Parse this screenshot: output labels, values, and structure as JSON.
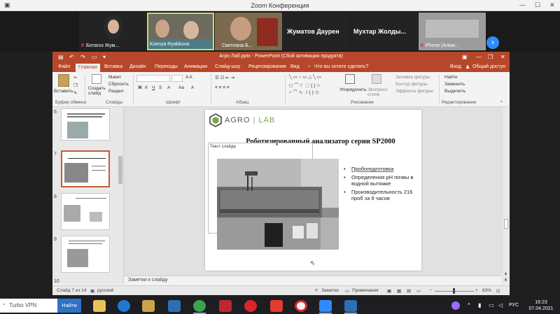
{
  "zoom": {
    "window_title": "Zoom Конференция",
    "participants": [
      {
        "name": "Ботагоз Жум..."
      },
      {
        "name": "Ksenya Ryabkova"
      },
      {
        "name": "Светлана Б..."
      },
      {
        "name": "Жуматов Даурен"
      },
      {
        "name": "Мухтар  Жолды..."
      },
      {
        "name": "Phone (Алма..."
      }
    ],
    "next_arrow": "›"
  },
  "ppt": {
    "window_title": "Агро Лаб.pptx - PowerPoint (Сбой активации продукта)",
    "tabs": [
      "Файл",
      "Главная",
      "Вставка",
      "Дизайн",
      "Переходы",
      "Анимации",
      "Слайд-шоу",
      "Рецензирование",
      "Вид"
    ],
    "tell_me": "Что вы хотите сделать?",
    "signin": "Вход",
    "share": "Общий доступ",
    "ribbon": {
      "paste": "Вставить",
      "create_slide": "Создать слайд",
      "layout": "Макет",
      "reset": "Сбросить",
      "section": "Раздел",
      "arrange": "Упорядочить",
      "quick_styles": "Экспресс-стили",
      "shape_fill": "Заливка фигуры",
      "shape_outline": "Контур фигуры",
      "shape_effects": "Эффекты фигуры",
      "find": "Найти",
      "replace": "Заменить",
      "select": "Выделить",
      "groups": {
        "clipboard": "Буфер обмена",
        "slides": "Слайды",
        "font": "Шрифт",
        "paragraph": "Абзац",
        "drawing": "Рисование",
        "editing": "Редактирование"
      }
    },
    "thumbs": [
      {
        "num": "6"
      },
      {
        "num": "7"
      },
      {
        "num": "8"
      },
      {
        "num": "9"
      },
      {
        "num": "10"
      }
    ],
    "slide": {
      "logo_agro": "AGRO",
      "logo_lab": "LAB",
      "title": "Роботизированный анализатор серии SP2000",
      "placeholder": "Текст слайда",
      "bullets": [
        "Пробоподготовка",
        "Определения pH почвы в водной вытяжке",
        "Производительность 216 проб за 8 часов"
      ]
    },
    "notes": "Заметки к слайду",
    "status": {
      "slide": "Слайд 7 из 14",
      "lang": "русский",
      "notes_btn": "Заметки",
      "comments_btn": "Примечания",
      "zoom": "63%"
    }
  },
  "taskbar": {
    "search": "Turbo VPN",
    "go": "Найти",
    "lang": "РУС",
    "time": "16:23",
    "date": "07.04.2021"
  },
  "colors": {
    "ppt_accent": "#b7472a",
    "zoom_blue": "#2d8cff",
    "logo_green": "#7aa93f"
  }
}
